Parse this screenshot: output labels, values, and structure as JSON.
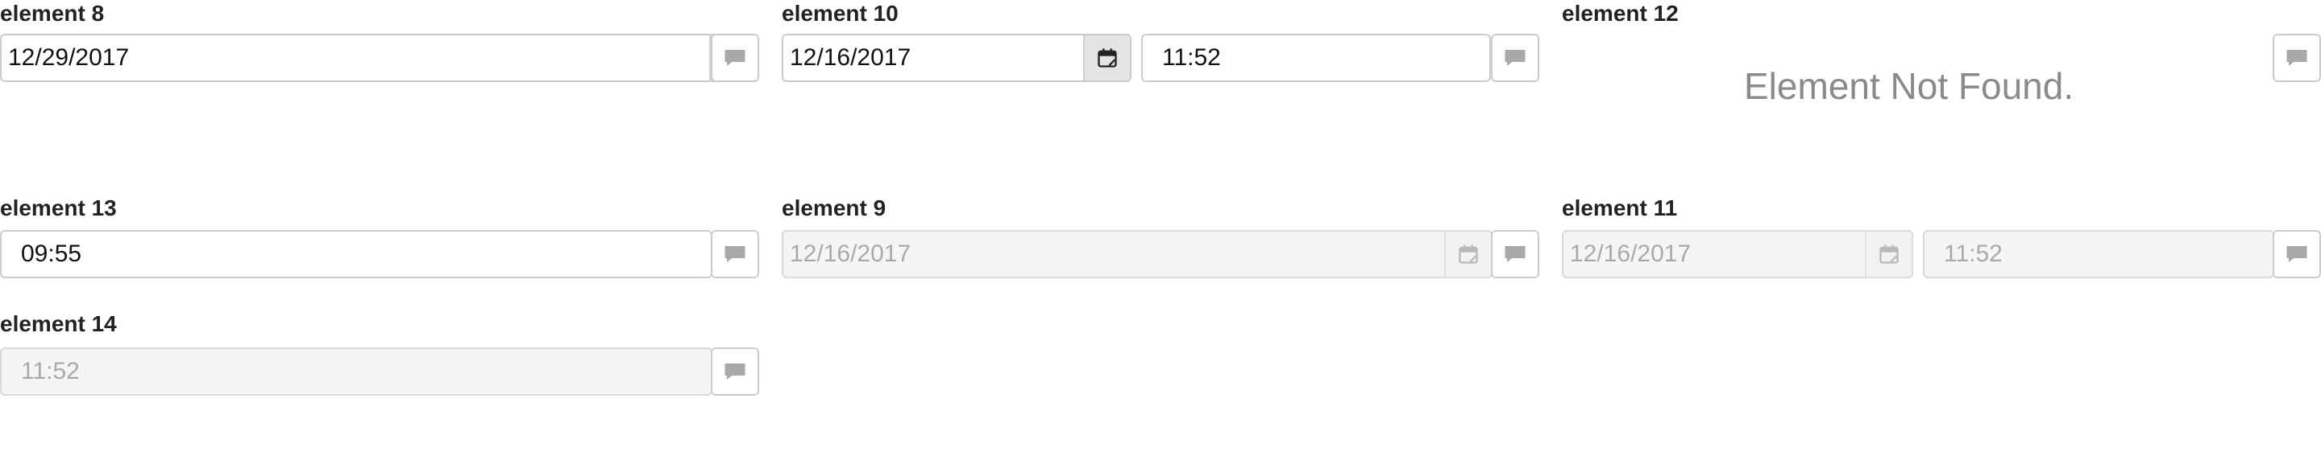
{
  "fields": {
    "el8": {
      "label": "element 8",
      "date": "12/29/2017"
    },
    "el10": {
      "label": "element 10",
      "date": "12/16/2017",
      "time": "11:52"
    },
    "el12": {
      "label": "element 12",
      "message": "Element Not Found."
    },
    "el13": {
      "label": "element 13",
      "time": "09:55"
    },
    "el9": {
      "label": "element 9",
      "date": "12/16/2017"
    },
    "el11": {
      "label": "element 11",
      "date": "12/16/2017",
      "time": "11:52"
    },
    "el14": {
      "label": "element 14",
      "time": "11:52"
    }
  },
  "icons": {
    "calendar": "calendar-icon",
    "comment": "comment-icon"
  },
  "colors": {
    "icon_active": "#222222",
    "icon_disabled": "#b8b8b8",
    "comment_icon": "#a8a8a8",
    "disabled_text": "#a9a9a9"
  }
}
